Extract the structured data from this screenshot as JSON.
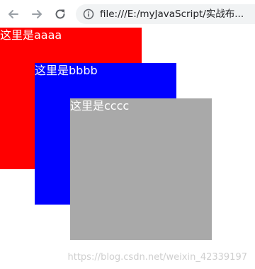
{
  "browser": {
    "url": "file:///E:/myJavaScript/实战布..."
  },
  "boxes": [
    {
      "label": "这里是aaaa",
      "color": "#ff0000"
    },
    {
      "label": "这里是bbbb",
      "color": "#0000ff"
    },
    {
      "label": "这里是cccc",
      "color": "#a9a9a9"
    }
  ],
  "watermark": "https://blog.csdn.net/weixin_42339197",
  "icons": {
    "back": "arrow-left-icon",
    "forward": "arrow-right-icon",
    "reload": "reload-icon",
    "info": "info-icon"
  }
}
